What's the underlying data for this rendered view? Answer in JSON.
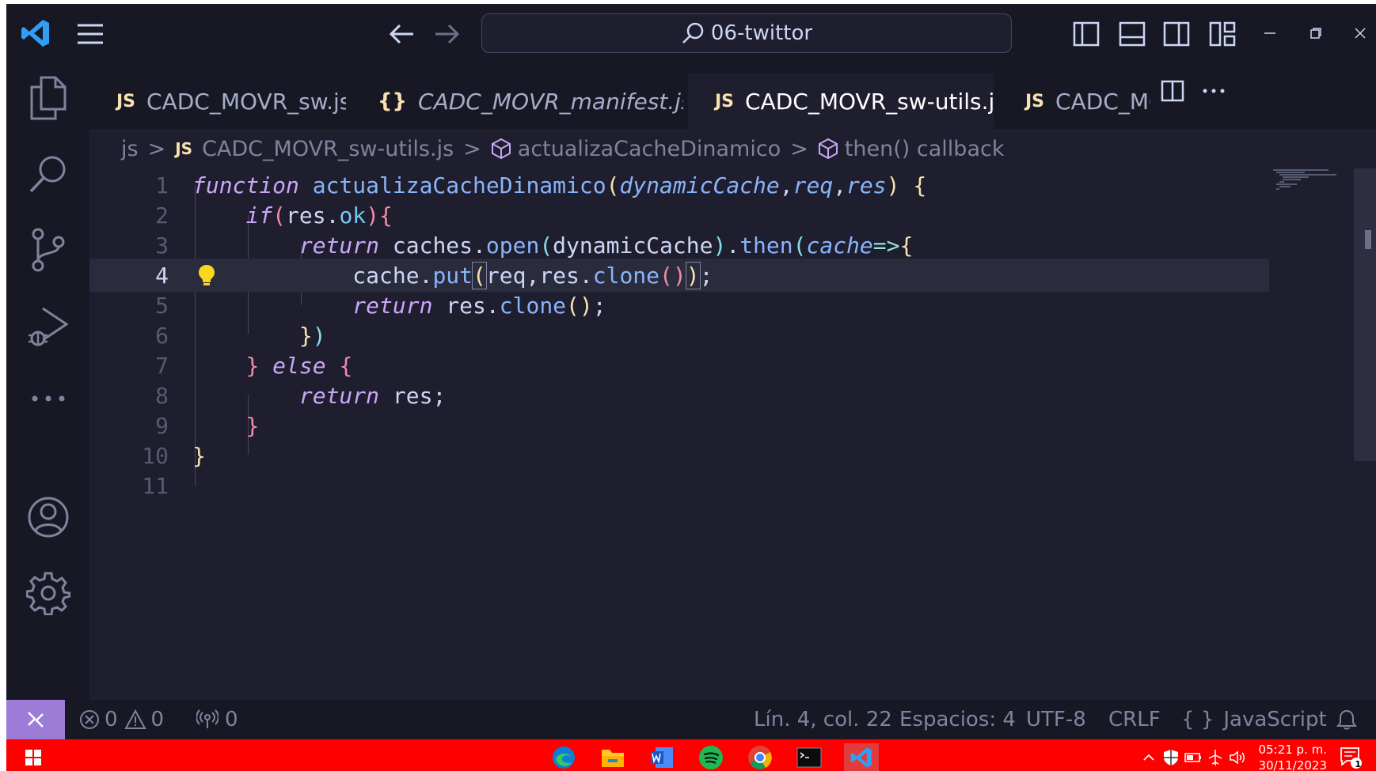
{
  "titlebar": {
    "search_text": "06-twittor"
  },
  "tabs": [
    {
      "icon": "JS",
      "label": "CADC_MOVR_sw.js"
    },
    {
      "icon": "{}",
      "label": "CADC_MOVR_manifest.json"
    },
    {
      "icon": "JS",
      "label": "CADC_MOVR_sw-utils.js",
      "close": "✕"
    },
    {
      "icon": "JS",
      "label": "CADC_MOV"
    }
  ],
  "breadcrumb": {
    "folder": "js",
    "file_icon": "JS",
    "file": "CADC_MOVR_sw-utils.js",
    "symbol1": "actualizaCacheDinamico",
    "symbol2": "then() callback",
    "separator": ">"
  },
  "editor": {
    "line_numbers": [
      "1",
      "2",
      "3",
      "4",
      "5",
      "6",
      "7",
      "8",
      "9",
      "10",
      "11"
    ],
    "current_line": 4
  },
  "statusbar": {
    "errors": "0",
    "warnings": "0",
    "ports": "0",
    "position": "Lín. 4, col. 22",
    "indent": "Espacios: 4",
    "encoding": "UTF-8",
    "eol": "CRLF",
    "language": "JavaScript"
  },
  "taskbar": {
    "time": "05:21 p. m.",
    "date": "30/11/2023",
    "notifications": "1"
  },
  "colors": {
    "accent": "#9d7cd8",
    "taskbar": "#ff0000",
    "editor_bg": "#1e1e2e"
  }
}
